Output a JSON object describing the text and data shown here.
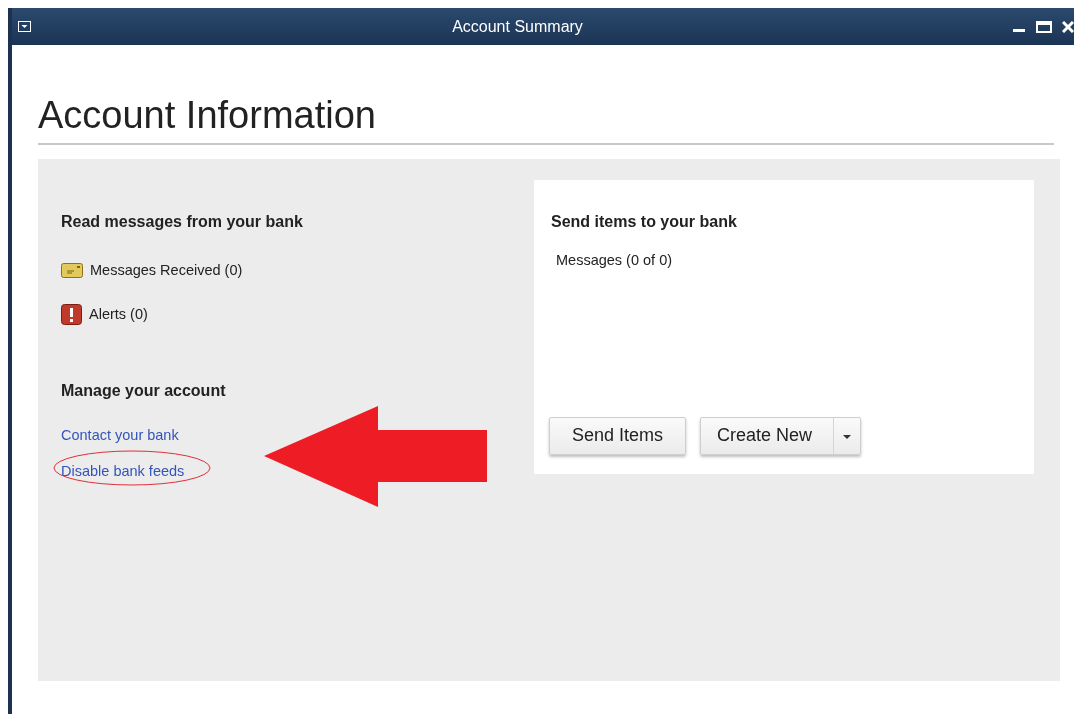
{
  "window": {
    "title": "Account Summary"
  },
  "heading": "Account Information",
  "read_section": {
    "title": "Read messages from your bank",
    "items": [
      {
        "kind": "message",
        "label": "Messages Received (0)"
      },
      {
        "kind": "alert",
        "label": "Alerts (0)"
      }
    ]
  },
  "manage_section": {
    "title": "Manage your account",
    "links": [
      {
        "label": "Contact your bank",
        "highlighted": false
      },
      {
        "label": "Disable bank feeds",
        "highlighted": true
      }
    ]
  },
  "send_section": {
    "title": "Send items to your bank",
    "messages": "Messages (0 of 0)",
    "buttons": [
      {
        "kind": "plain",
        "label": "Send Items"
      },
      {
        "kind": "split",
        "label": "Create New"
      }
    ]
  }
}
